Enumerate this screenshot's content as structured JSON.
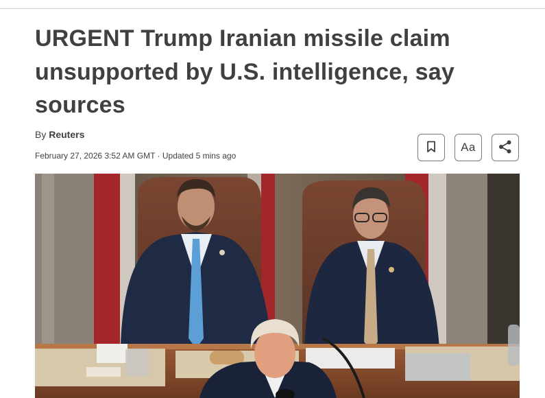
{
  "article": {
    "headline": "URGENT Trump Iranian missile claim unsupported by U.S. intelligence, say sources",
    "byline_prefix": "By ",
    "author": "Reuters",
    "dateline": "February 27, 2026 3:52 AM GMT · Updated 5 mins ago"
  },
  "toolbar": {
    "bookmark_icon": "bookmark-icon",
    "font_size_label": "Aa",
    "share_icon": "share-icon"
  },
  "hero_image": {
    "subject": "photo-three-men-chamber"
  },
  "colors": {
    "text": "#404040",
    "border": "#7a7a7a"
  }
}
